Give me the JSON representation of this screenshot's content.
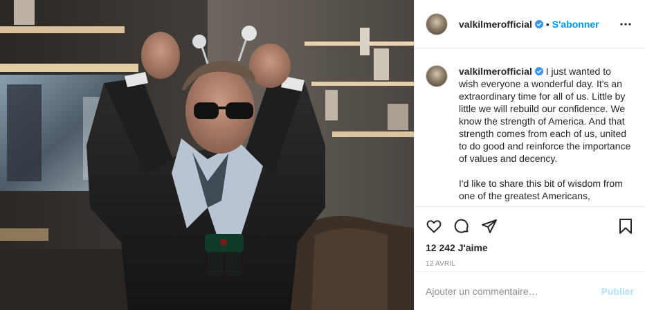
{
  "post": {
    "username": "valkilmerofficial",
    "follow_label": "S'abonner",
    "separator": "•",
    "caption_paragraphs": [
      "I just wanted to wish everyone a wonderful day. It's an extraordinary time for all of us. Little by little we will rebuild our confidence. We know the strength of America. And that strength comes from each of us, united to do good and reinforce the importance of values and decency.",
      "I'd like to share this bit of wisdom from one of the greatest Americans,"
    ],
    "likes_text": "12 242 J'aime",
    "date_text": "12 AVRIL"
  },
  "comment_box": {
    "placeholder": "Ajouter un commentaire…",
    "publish_label": "Publier"
  },
  "colors": {
    "accent": "#0095f6",
    "verified": "#3897f0",
    "muted": "#8e8e8e",
    "publish_disabled": "#b2dffc"
  },
  "icons": [
    "verified-badge-icon",
    "more-options-icon",
    "heart-icon",
    "comment-icon",
    "share-icon",
    "bookmark-icon"
  ]
}
